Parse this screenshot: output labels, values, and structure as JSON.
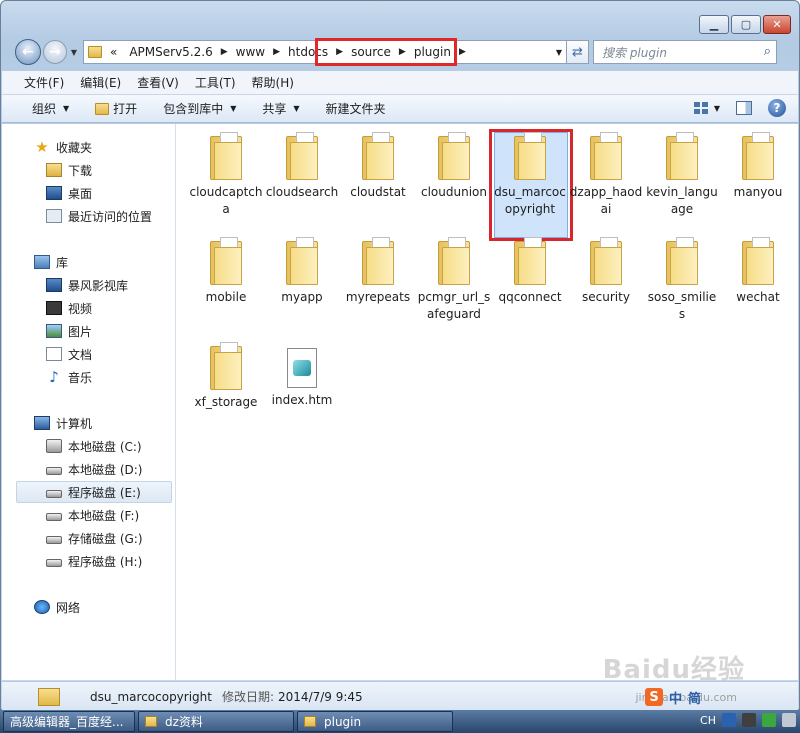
{
  "window": {
    "buttons": {
      "minimize": "▁",
      "maximize": "▢",
      "close": "✕"
    }
  },
  "address": {
    "prefix": "«",
    "crumbs": [
      "APMServ5.2.6",
      "www",
      "htdocs",
      "source",
      "plugin"
    ],
    "search_placeholder": "搜索 plugin"
  },
  "menu": [
    "文件(F)",
    "编辑(E)",
    "查看(V)",
    "工具(T)",
    "帮助(H)"
  ],
  "commands": {
    "organize": "组织",
    "open": "打开",
    "include_library": "包含到库中",
    "share": "共享",
    "new_folder": "新建文件夹"
  },
  "nav": {
    "favorites": "收藏夹",
    "downloads": "下载",
    "desktop": "桌面",
    "recent": "最近访问的位置",
    "libraries": "库",
    "storm": "暴风影视库",
    "videos": "视频",
    "pictures": "图片",
    "documents": "文档",
    "music": "音乐",
    "computer": "计算机",
    "drive_c": "本地磁盘 (C:)",
    "drive_d": "本地磁盘 (D:)",
    "drive_e": "程序磁盘 (E:)",
    "drive_f": "本地磁盘 (F:)",
    "drive_g": "存储磁盘 (G:)",
    "drive_h": "程序磁盘 (H:)",
    "network": "网络"
  },
  "files": [
    "cloudcaptcha",
    "cloudsearch",
    "cloudstat",
    "cloudunion",
    "dsu_marcocopyright",
    "dzapp_haodai",
    "kevin_language",
    "manyou",
    "mobile",
    "myapp",
    "myrepeats",
    "pcmgr_url_safeguard",
    "qqconnect",
    "security",
    "soso_smilies",
    "wechat",
    "xf_storage",
    "index.htm"
  ],
  "details": {
    "name": "dsu_marcocopyright",
    "modified_label": "修改日期:",
    "modified_value": "2014/7/9 9:45"
  },
  "ime": {
    "brand": "S",
    "lang": "中",
    "mode": "简"
  },
  "watermark": {
    "main": "Baidu经验",
    "sub": "jingyan.baidu.com"
  },
  "taskbar": {
    "items": [
      "高级编辑器_百度经...",
      "dz资料",
      "plugin"
    ],
    "tray_text": "CH"
  }
}
